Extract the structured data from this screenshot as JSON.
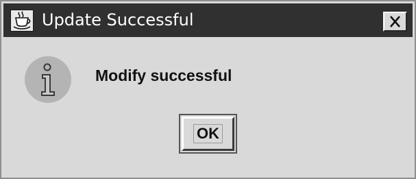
{
  "window": {
    "title": "Update Successful",
    "app_icon": "java-cup-icon",
    "close_icon": "close-icon"
  },
  "content": {
    "icon": "information-icon",
    "message": "Modify successful"
  },
  "buttons": {
    "ok_label": "OK"
  },
  "colors": {
    "titlebar_background": "#303030",
    "title_text": "#ffffff",
    "dialog_background": "#d9d9d9"
  }
}
